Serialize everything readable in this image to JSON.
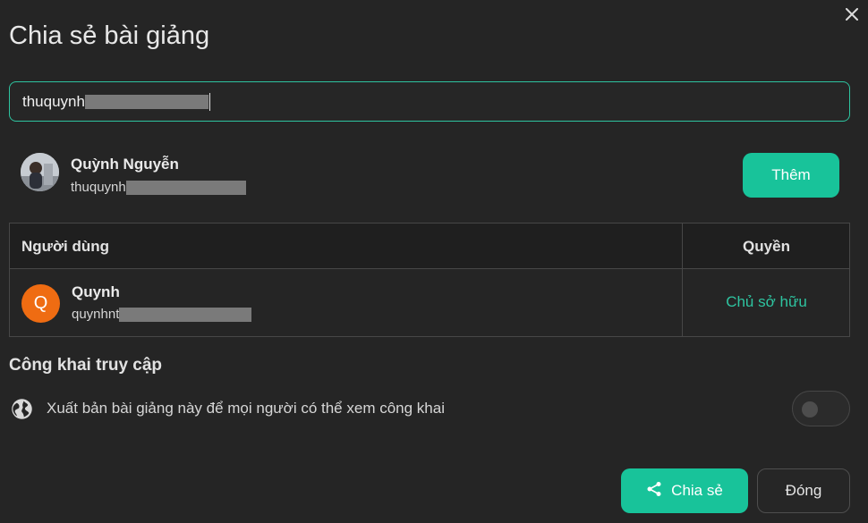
{
  "dialog": {
    "title": "Chia sẻ bài giảng",
    "close_icon": "close-icon"
  },
  "search": {
    "value": "thuquynh"
  },
  "suggestion": {
    "name": "Quỳnh Nguyễn",
    "email": "thuquynh",
    "add_label": "Thêm"
  },
  "table": {
    "headers": {
      "user": "Người dùng",
      "permission": "Quyền"
    },
    "rows": [
      {
        "avatar_letter": "Q",
        "avatar_color": "#ef6c12",
        "name": "Quynh",
        "email": "quynhnt",
        "permission": "Chủ sở hữu"
      }
    ]
  },
  "public_access": {
    "title": "Công khai truy cập",
    "description": "Xuất bản bài giảng này để mọi người có thể xem công khai",
    "icon": "globe-icon",
    "enabled": false
  },
  "footer": {
    "share_label": "Chia sẻ",
    "share_icon": "share-icon",
    "close_label": "Đóng"
  },
  "colors": {
    "accent": "#18c39a",
    "background": "#252525",
    "owner_text": "#2ec4a0"
  }
}
